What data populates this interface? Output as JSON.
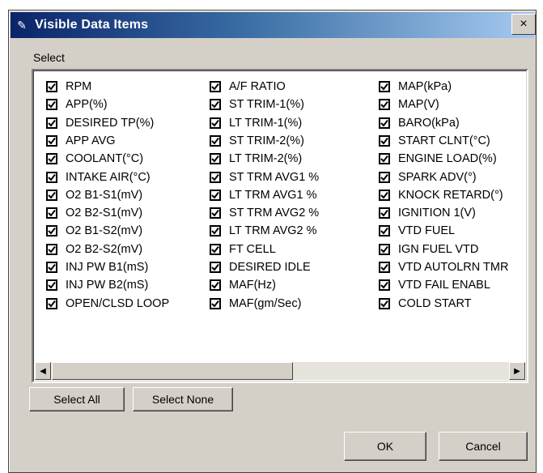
{
  "window": {
    "title": "Visible Data Items",
    "close_label": "×"
  },
  "select_label": "Select",
  "columns": [
    [
      "RPM",
      "APP(%)",
      "DESIRED TP(%)",
      "APP AVG",
      "COOLANT(°C)",
      "INTAKE AIR(°C)",
      "O2 B1-S1(mV)",
      "O2 B2-S1(mV)",
      "O2 B1-S2(mV)",
      "O2 B2-S2(mV)",
      "INJ PW B1(mS)",
      "INJ PW B2(mS)",
      "OPEN/CLSD LOOP"
    ],
    [
      "A/F RATIO",
      "ST TRIM-1(%)",
      "LT TRIM-1(%)",
      "ST TRIM-2(%)",
      "LT TRIM-2(%)",
      "ST TRM AVG1 %",
      "LT TRM AVG1 %",
      "ST TRM AVG2 %",
      "LT TRM AVG2 %",
      "FT CELL",
      "DESIRED IDLE",
      "MAF(Hz)",
      "MAF(gm/Sec)"
    ],
    [
      "MAP(kPa)",
      "MAP(V)",
      "BARO(kPa)",
      "START CLNT(°C)",
      "ENGINE LOAD(%)",
      "SPARK ADV(°)",
      "KNOCK RETARD(°)",
      "IGNITION 1(V)",
      "VTD FUEL",
      "IGN FUEL VTD",
      "VTD AUTOLRN TMR",
      "VTD FAIL ENABL",
      "COLD START"
    ]
  ],
  "buttons": {
    "select_all": "Select All",
    "select_none": "Select None",
    "ok": "OK",
    "cancel": "Cancel"
  }
}
